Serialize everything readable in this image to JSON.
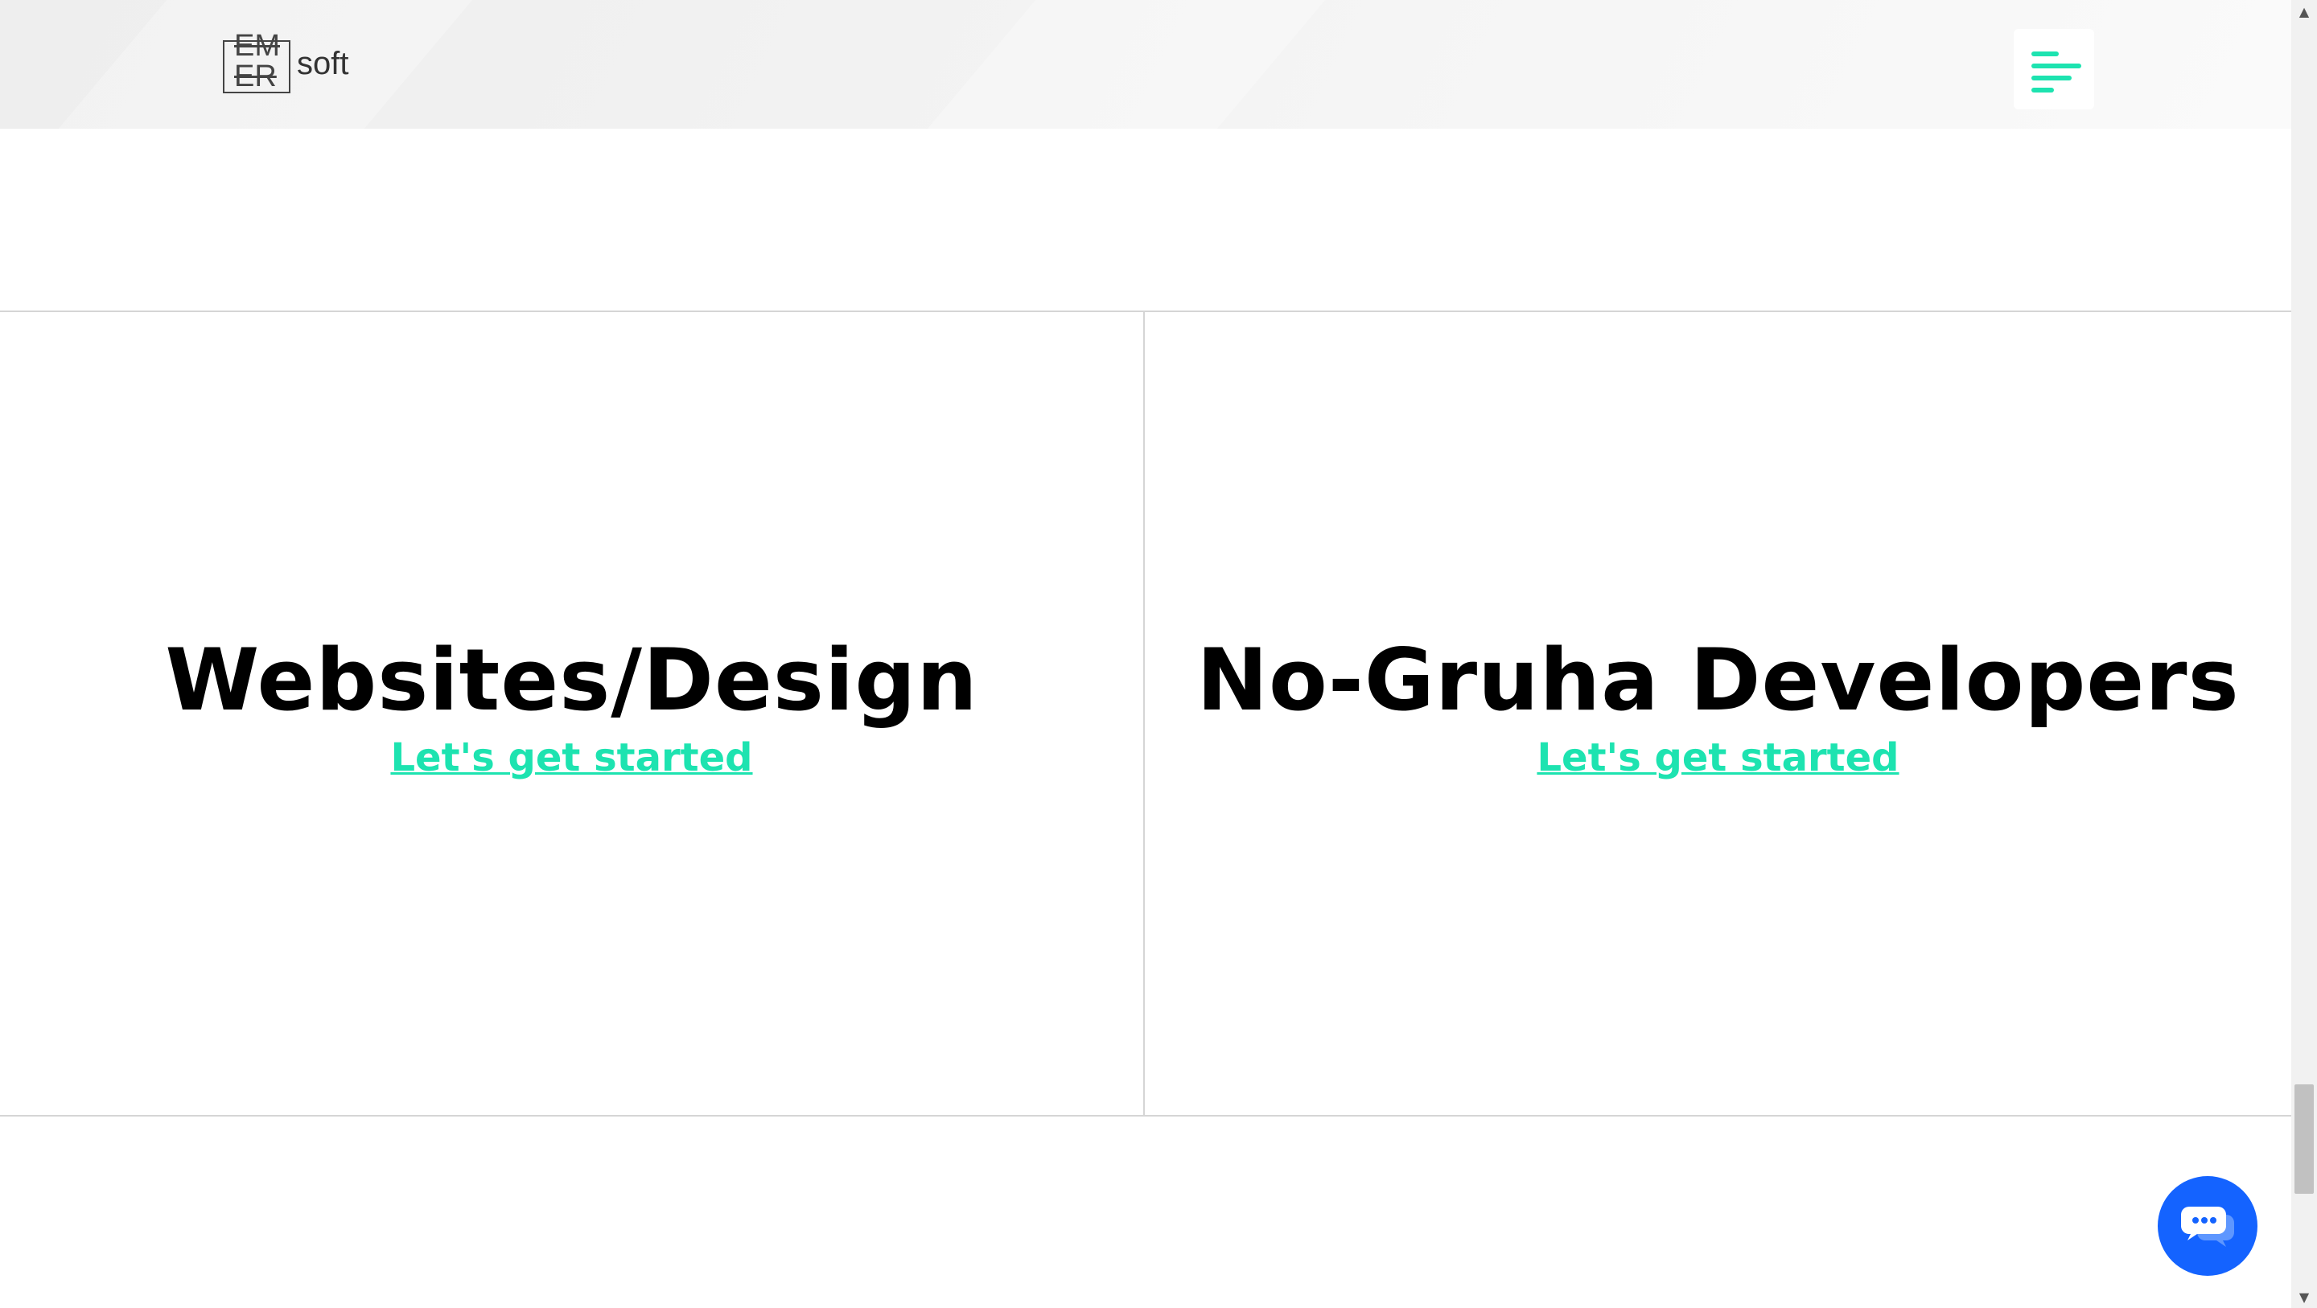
{
  "header": {
    "logo": {
      "box_line1": "EM",
      "box_line2": "ER",
      "word": "soft"
    },
    "menu_icon": "hamburger-menu-icon",
    "accent_color": "#1de3b0"
  },
  "services": [
    {
      "title": "Websites/Design",
      "link": "Let's get started"
    },
    {
      "title": "No-Gruha Developers",
      "link": "Let's get started"
    }
  ],
  "chat": {
    "icon": "chat-bubble-icon",
    "color": "#1463ff"
  }
}
